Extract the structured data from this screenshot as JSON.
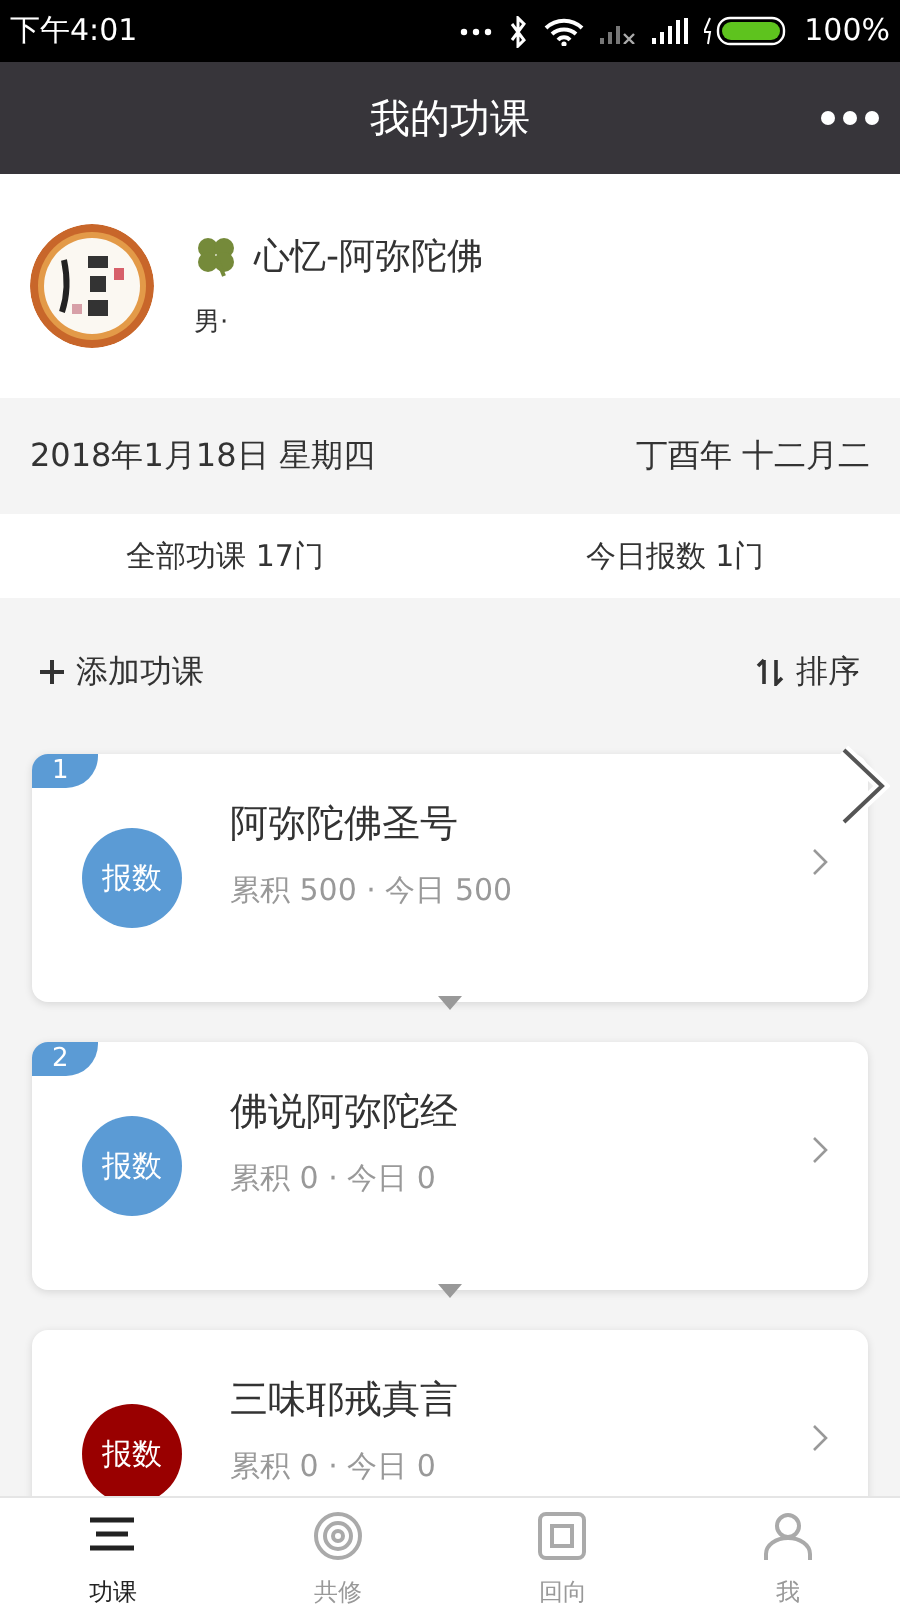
{
  "status_bar": {
    "time": "下午4:01",
    "battery": "100%"
  },
  "header": {
    "title": "我的功课"
  },
  "profile": {
    "name": "心忆-阿弥陀佛",
    "gender": "男·"
  },
  "date_row": {
    "solar": "2018年1月18日 星期四",
    "lunar": "丁酉年 十二月二"
  },
  "stats": [
    "全部功课 17门",
    "今日报数 1门"
  ],
  "actions": {
    "add": "添加功课",
    "sort": "排序"
  },
  "lessons": [
    {
      "number": "1",
      "button": "报数",
      "color": "#5b9bd5",
      "title": "阿弥陀佛圣号",
      "summary": "累积 500 · 今日 500"
    },
    {
      "number": "2",
      "button": "报数",
      "color": "#5b9bd5",
      "title": "佛说阿弥陀经",
      "summary": "累积 0 · 今日 0"
    },
    {
      "button": "报数",
      "color": "#990000",
      "title": "三味耶戒真言",
      "summary": "累积 0 · 今日 0"
    }
  ],
  "tab_bar": [
    {
      "kind": "list",
      "label": "功课",
      "selected": true
    },
    {
      "kind": "target",
      "label": "共修",
      "selected": false
    },
    {
      "kind": "square",
      "label": "回向",
      "selected": false
    },
    {
      "kind": "person",
      "label": "我",
      "selected": false
    }
  ]
}
